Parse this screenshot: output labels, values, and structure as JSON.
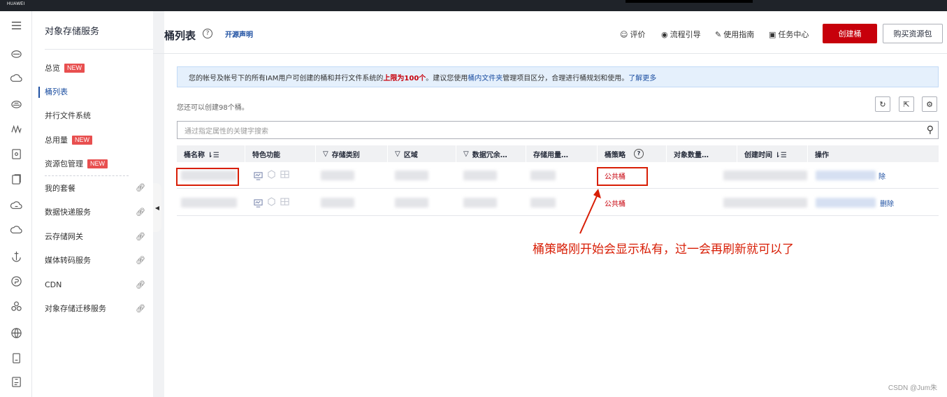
{
  "topbar": {
    "logo": "HUAWEI"
  },
  "rail": [
    "menu-icon",
    "cloud-icon-1",
    "cloud-icon-2",
    "cloud-icon-3",
    "wave-icon",
    "disk-icon",
    "file-icon",
    "cloud-icon-4",
    "cloud-icon-5",
    "anchor-icon",
    "coin-icon",
    "network-icon",
    "globe-icon",
    "document-icon",
    "archive-icon"
  ],
  "sidebar": {
    "title": "对象存储服务",
    "items": [
      {
        "label": "总览",
        "badge": "NEW"
      },
      {
        "label": "桶列表"
      },
      {
        "label": "并行文件系统"
      },
      {
        "label": "总用量",
        "badge": "NEW"
      },
      {
        "label": "资源包管理",
        "badge": "NEW"
      },
      {
        "label": "我的套餐"
      },
      {
        "label": "数据快递服务"
      },
      {
        "label": "云存储网关"
      },
      {
        "label": "媒体转码服务"
      },
      {
        "label": "CDN"
      },
      {
        "label": "对象存储迁移服务"
      }
    ]
  },
  "header": {
    "title": "桶列表",
    "open_source": "开源声明",
    "toolbar": {
      "rate": "评价",
      "guide": "流程引导",
      "manual": "使用指南",
      "tasks": "任务中心",
      "create": "创建桶",
      "buy": "购买资源包"
    }
  },
  "notice": {
    "part1": "您的帐号及帐号下的所有IAM用户可创建的桶和并行文件系统的",
    "highlight": "上限为100个",
    "part2": "。建议您使用",
    "link1": "桶内文件夹",
    "part3": "管理项目区分，合理进行桶规划和使用。",
    "link2": "了解更多"
  },
  "quota_text": "您还可以创建98个桶。",
  "search": {
    "placeholder": "通过指定属性的关键字搜索"
  },
  "table": {
    "headers": [
      "桶名称 ⇂☰",
      "特色功能",
      "存储类别",
      "区域",
      "数据冗余…",
      "存储用量…",
      "桶策略",
      "对象数量…",
      "创建时间 ⇂☰",
      "操作"
    ],
    "rows": [
      {
        "policy": "公共桶",
        "action": "除"
      },
      {
        "policy": "公共桶",
        "action": "删除"
      }
    ]
  },
  "annotation": "桶策略刚开始会显示私有，过一会再刷新就可以了",
  "watermark": "CSDN @Jum朱"
}
